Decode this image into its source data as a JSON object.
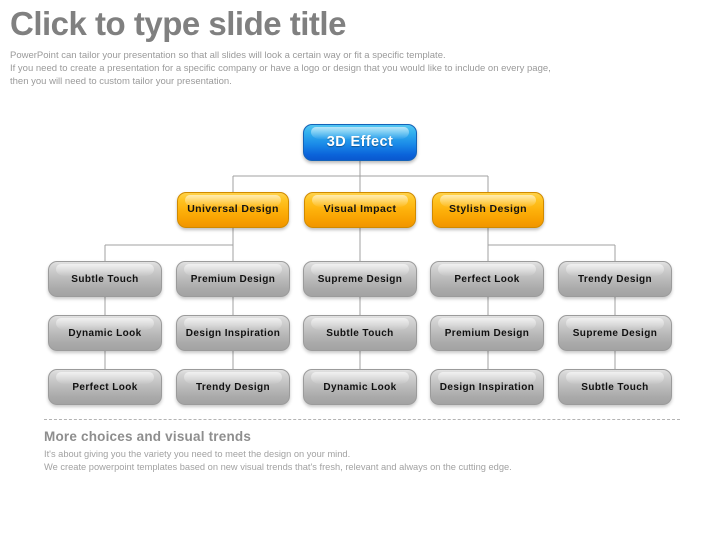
{
  "slide": {
    "title": "Click to type slide title",
    "subtitle_lines": [
      "PowerPoint can tailor your presentation so that all slides will look a certain way or fit a specific template.",
      "If you need to create a presentation for a specific company or have a logo or design that you would like to include on every page,",
      "then you will need to custom tailor your presentation."
    ]
  },
  "diagram": {
    "root": {
      "label": "3D Effect",
      "color": "#1a8ae8"
    },
    "level2": [
      {
        "label": "Universal Design",
        "color": "#fdb00a"
      },
      {
        "label": "Visual Impact",
        "color": "#fdb00a"
      },
      {
        "label": "Stylish Design",
        "color": "#fdb00a"
      }
    ],
    "level3_rows": [
      [
        {
          "label": "Subtle Touch"
        },
        {
          "label": "Premium Design"
        },
        {
          "label": "Supreme Design"
        },
        {
          "label": "Perfect Look"
        },
        {
          "label": "Trendy Design"
        }
      ],
      [
        {
          "label": "Dynamic Look"
        },
        {
          "label": "Design Inspiration"
        },
        {
          "label": "Subtle Touch"
        },
        {
          "label": "Premium Design"
        },
        {
          "label": "Supreme Design"
        }
      ],
      [
        {
          "label": "Perfect Look"
        },
        {
          "label": "Trendy Design"
        },
        {
          "label": "Dynamic Look"
        },
        {
          "label": "Design Inspiration"
        },
        {
          "label": "Subtle Touch"
        }
      ]
    ],
    "connector_color": "#a0a0a0",
    "gray_node_color": "#bcbcbc"
  },
  "footer": {
    "heading": "More choices and visual trends",
    "body_lines": [
      "It's about giving you the variety you need to meet the design on your mind.",
      "We create powerpoint templates based on new visual trends that's fresh, relevant and always on the cutting edge."
    ]
  }
}
